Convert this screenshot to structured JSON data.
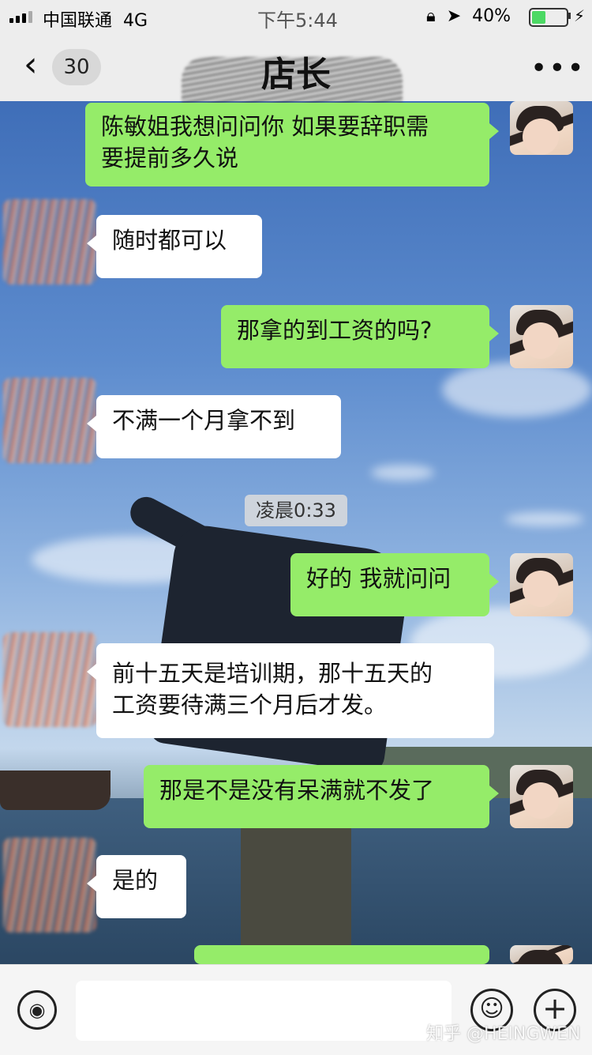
{
  "status_bar": {
    "carrier": "中国联通",
    "network": "4G",
    "time": "下午5:44",
    "battery": "40%",
    "battery_level": 0.4
  },
  "header": {
    "back_count": "30",
    "title": "店长"
  },
  "messages": [
    {
      "sender": "me",
      "text_line1": "陈敏姐我想问问你 如果要辞职需",
      "text_line2": "要提前多久说"
    },
    {
      "sender": "them",
      "text": "随时都可以"
    },
    {
      "sender": "me",
      "text": "那拿的到工资的吗?"
    },
    {
      "sender": "them",
      "text": "不满一个月拿不到"
    },
    {
      "sender": "me",
      "text": "好的 我就问问"
    },
    {
      "sender": "them",
      "text_line1": "前十五天是培训期，那十五天的",
      "text_line2": "工资要待满三个月后才发。"
    },
    {
      "sender": "me",
      "text": "那是不是没有呆满就不发了"
    },
    {
      "sender": "them",
      "text": "是的"
    }
  ],
  "timestamp": "凌晨0:33",
  "watermark": "知乎 @HEINGWEN",
  "icons": {
    "back": "chevron-left-icon",
    "more": "more-dots-icon",
    "voice": "voice-icon",
    "emoji": "emoji-icon",
    "plus": "plus-icon"
  },
  "colors": {
    "my_bubble": "#95ec69",
    "their_bubble": "#ffffff",
    "bar_background": "#ededed"
  }
}
